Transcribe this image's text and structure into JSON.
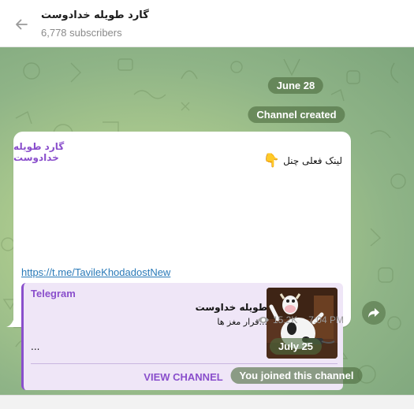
{
  "header": {
    "title": "گارد طویله خدادوست",
    "subscribers": "6,778 subscribers"
  },
  "dates": {
    "first": "June 28",
    "second": "July 25"
  },
  "service": {
    "created": "Channel created",
    "joined": "You joined this channel"
  },
  "message": {
    "sender": "گارد طویله خدادوست",
    "text": "لینک فعلی چنل",
    "emoji": "👇",
    "link": "https://t.me/TavileKhodadostNew",
    "preview": {
      "site": "Telegram",
      "title": "طویله خداوست",
      "description": "فرار مغز ها...",
      "ellipsis": "...",
      "button": "VIEW CHANNEL"
    },
    "views": "15.2K",
    "time": "7:04 PM"
  },
  "colors": {
    "accent": "#8a4fcc",
    "link": "#2a7ab8",
    "pill_bg": "#4e6c3f"
  },
  "icons": {
    "back": "arrow-left-icon",
    "views": "eye-icon",
    "share": "share-arrow-icon"
  }
}
